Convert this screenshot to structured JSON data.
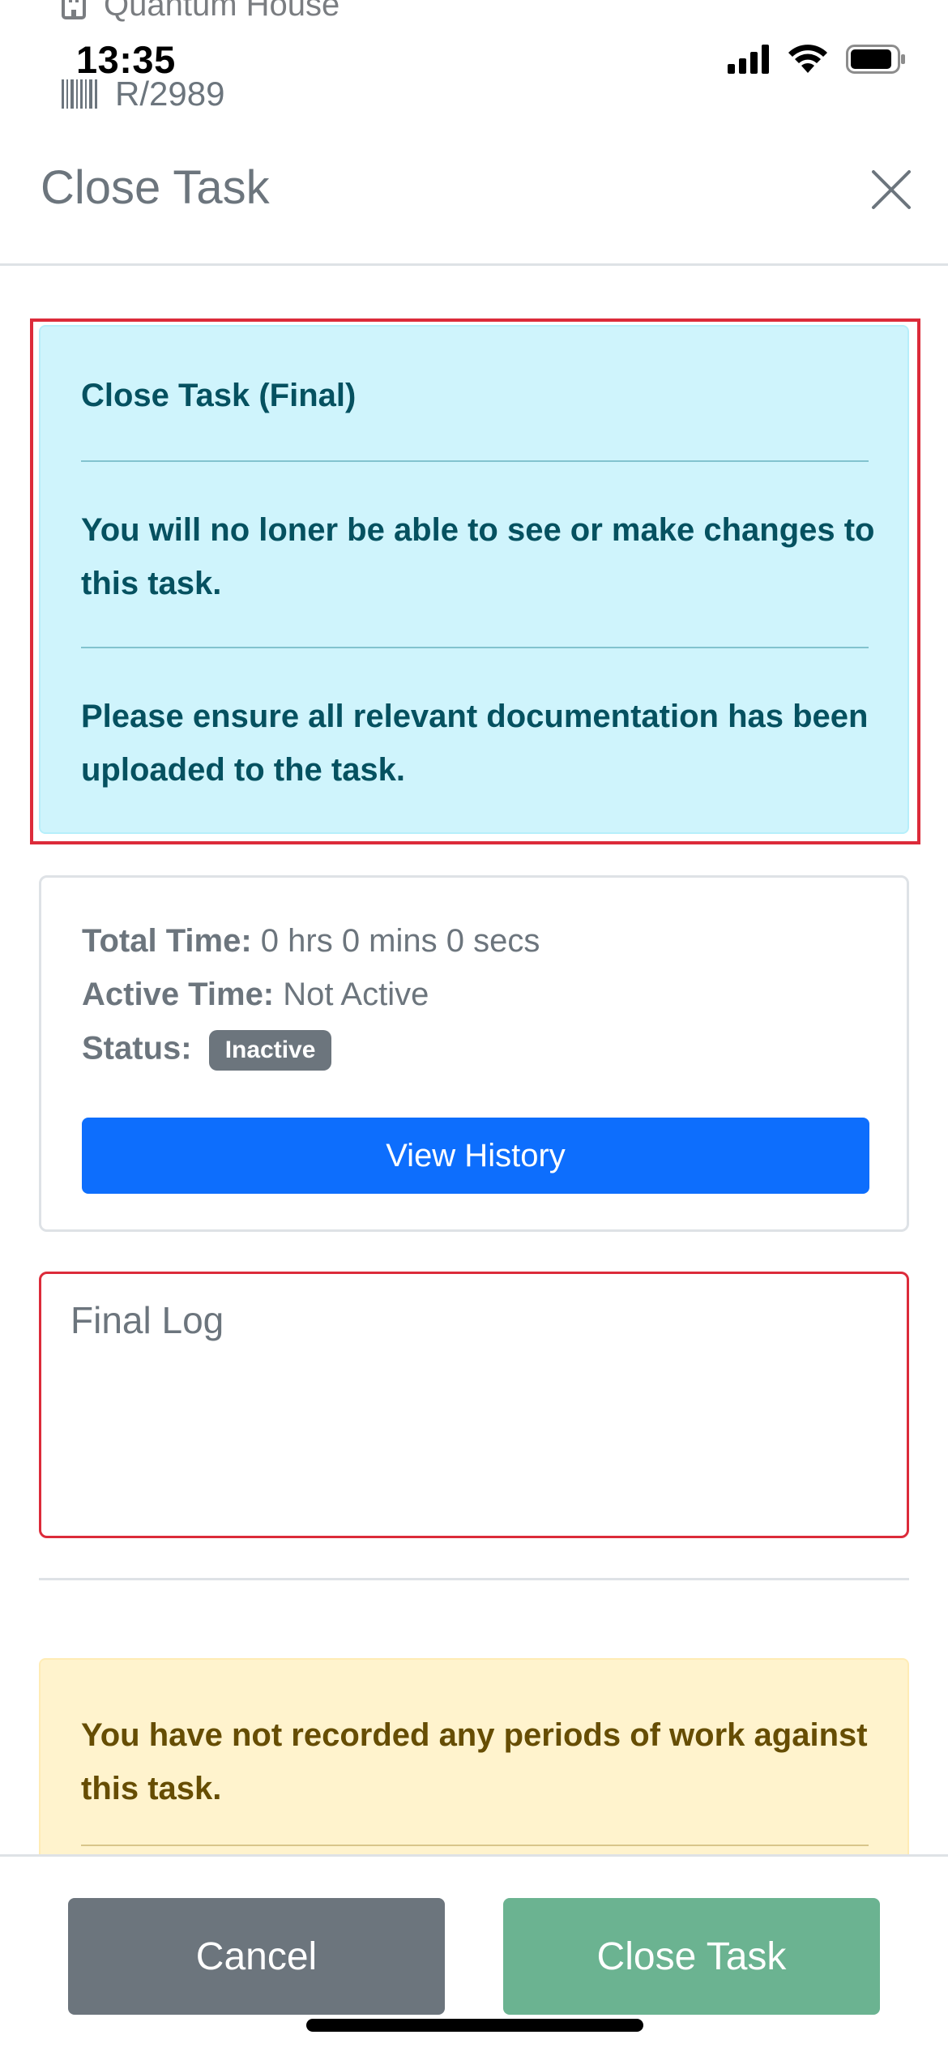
{
  "status_bar": {
    "time": "13:35",
    "background_location": "Quantum House",
    "task_reference": "R/2989"
  },
  "modal": {
    "title": "Close Task"
  },
  "info_alert": {
    "heading": "Close Task (Final)",
    "message_1": "You will no loner be able to see or make changes to this task.",
    "message_2": "Please ensure all relevant documentation has been uploaded to the task."
  },
  "time_card": {
    "total_time_label": "Total Time:",
    "total_time_value": "0 hrs 0 mins 0 secs",
    "active_time_label": "Active Time:",
    "active_time_value": "Not Active",
    "status_label": "Status:",
    "status_badge": "Inactive",
    "view_history_label": "View History"
  },
  "final_log": {
    "placeholder": "Final Log",
    "value": ""
  },
  "warning_alert": {
    "message": "You have not recorded any periods of work against this task."
  },
  "footer": {
    "cancel_label": "Cancel",
    "close_task_label": "Close Task"
  },
  "colors": {
    "primary": "#0d6efd",
    "secondary": "#6c757d",
    "success_disabled": "#6bb391",
    "info_bg": "#cff4fc",
    "info_text": "#055160",
    "warning_bg": "#fff3cd",
    "warning_text": "#664d03",
    "highlight_red": "#dc2b3a"
  }
}
